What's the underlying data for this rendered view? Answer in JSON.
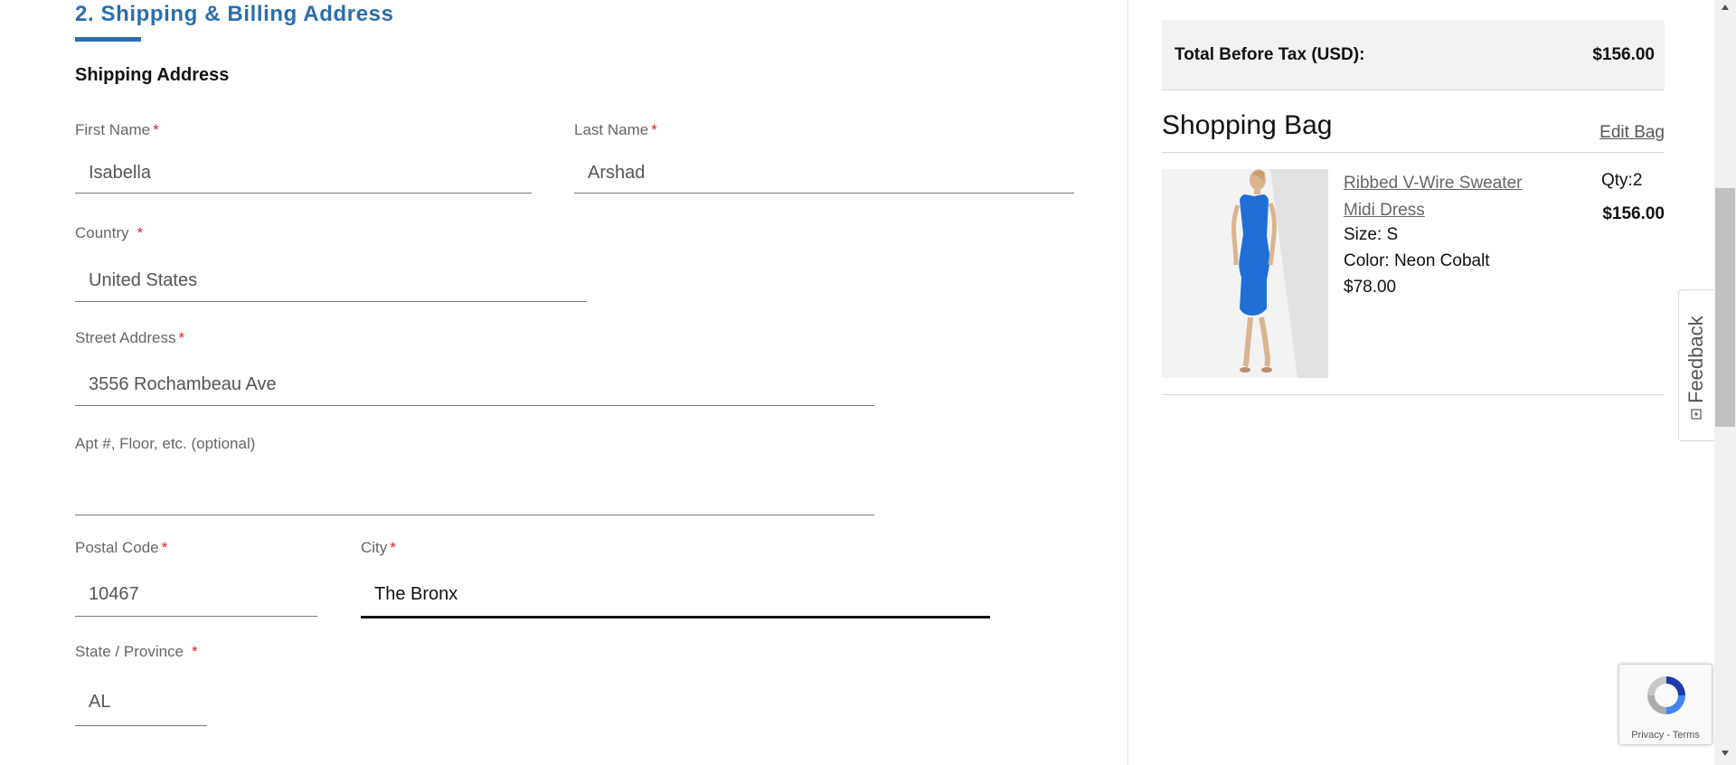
{
  "form": {
    "section_title": "2. Shipping & Billing Address",
    "shipping_heading": "Shipping Address",
    "required_mark": "*",
    "first_name": {
      "label": "First Name",
      "value": "Isabella"
    },
    "last_name": {
      "label": "Last Name",
      "value": "Arshad"
    },
    "country": {
      "label": "Country",
      "value": "United States"
    },
    "street": {
      "label": "Street Address",
      "value": "3556 Rochambeau Ave"
    },
    "apt": {
      "label": "Apt #, Floor, etc. (optional)",
      "value": ""
    },
    "postal": {
      "label": "Postal Code",
      "value": "10467"
    },
    "city": {
      "label": "City",
      "value": "The Bronx"
    },
    "state": {
      "label": "State / Province",
      "value": "AL"
    }
  },
  "summary": {
    "total_label": "Total Before Tax (USD):",
    "total_value": "$156.00",
    "bag_title": "Shopping Bag",
    "edit_bag": "Edit Bag",
    "item": {
      "name": "Ribbed V-Wire Sweater Midi Dress",
      "size": "Size: S",
      "color": "Color: Neon Cobalt",
      "price": "$78.00",
      "qty": "Qty:2",
      "line_total": "$156.00",
      "dress_color": "#1f6fd6"
    }
  },
  "feedback": {
    "label": "Feedback"
  },
  "recaptcha": {
    "privacy": "Privacy",
    "separator": " - ",
    "terms": "Terms"
  },
  "colors": {
    "accent": "#2a6ead",
    "required": "#e02020"
  }
}
